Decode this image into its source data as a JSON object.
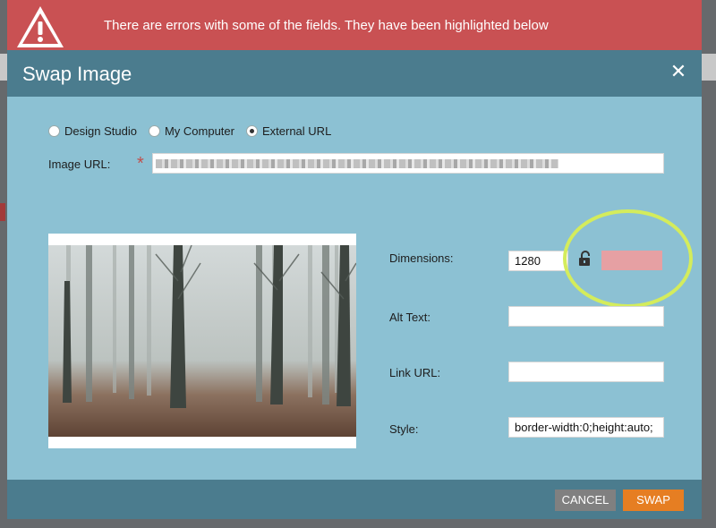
{
  "error_banner": {
    "message": "There are errors with some of the fields. They have been highlighted below",
    "icon": "warning-triangle-icon",
    "color": "#c95153"
  },
  "modal": {
    "title": "Swap Image",
    "close_icon": "close-icon",
    "source_options": [
      {
        "label": "Design Studio",
        "checked": false
      },
      {
        "label": "My Computer",
        "checked": false
      },
      {
        "label": "External URL",
        "checked": true
      }
    ],
    "image_url": {
      "label": "Image URL:",
      "required_mark": "*",
      "value_redacted": true
    },
    "dimensions": {
      "label": "Dimensions:",
      "width_value": "1280",
      "height_value": "",
      "height_error": true,
      "lock_icon": "lock-open-icon"
    },
    "alt_text": {
      "label": "Alt Text:",
      "value": ""
    },
    "link_url": {
      "label": "Link URL:",
      "value": ""
    },
    "style": {
      "label": "Style:",
      "value": "border-width:0;height:auto;"
    },
    "footer": {
      "cancel_label": "CANCEL",
      "swap_label": "SWAP"
    }
  },
  "colors": {
    "header": "#4b7c8e",
    "body": "#8cc1d3",
    "error_field": "#e6a0a3",
    "highlight_ring": "#d4ec5c",
    "swap_button": "#e67e22",
    "cancel_button": "#808080"
  }
}
